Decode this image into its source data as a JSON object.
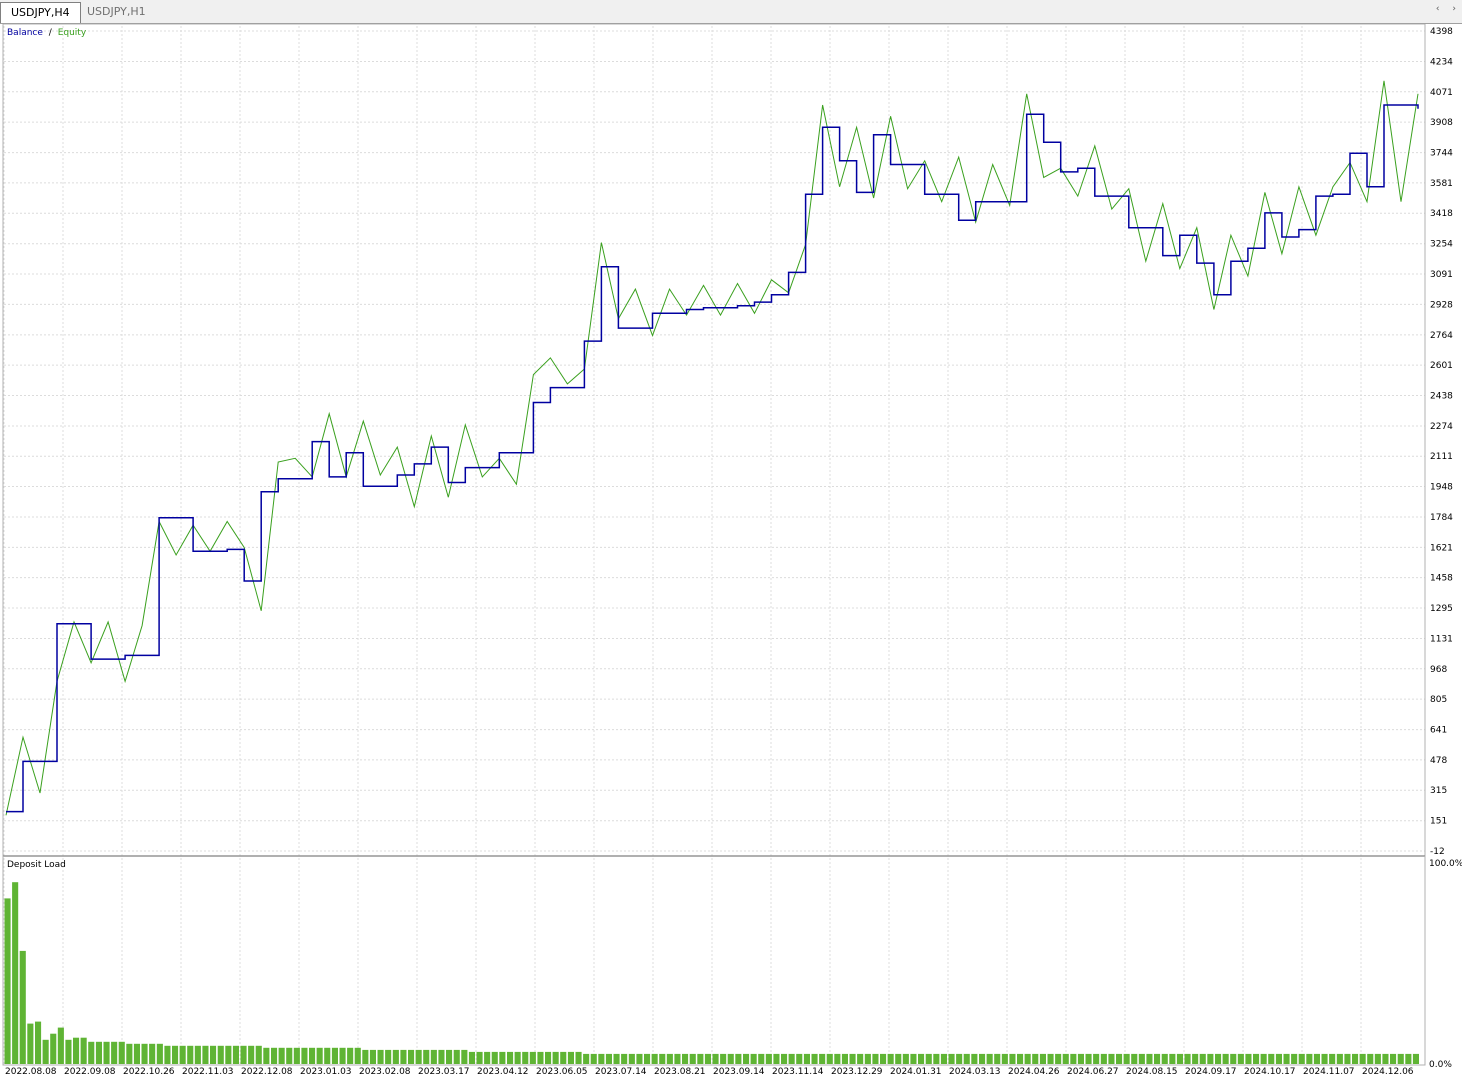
{
  "tabs": [
    {
      "label": "USDJPY,H4",
      "active": true
    },
    {
      "label": "USDJPY,H1",
      "active": false
    }
  ],
  "tab_arrows": {
    "left": "‹",
    "right": "›"
  },
  "colors": {
    "balance": "#0000a0",
    "equity": "#3aa01e",
    "deposit": "#5fb434",
    "grid": "#dcdcdc"
  },
  "chart_data": [
    {
      "type": "line",
      "legend": {
        "balance_label": "Balance",
        "separator": "/",
        "equity_label": "Equity",
        "position": "top-left"
      },
      "y_ticks": [
        "4398",
        "4234",
        "4071",
        "3908",
        "3744",
        "3581",
        "3418",
        "3254",
        "3091",
        "2928",
        "2764",
        "2601",
        "2438",
        "2274",
        "2111",
        "1948",
        "1784",
        "1621",
        "1458",
        "1295",
        "1131",
        "968",
        "805",
        "641",
        "478",
        "315",
        "151",
        "-12"
      ],
      "ylim": [
        -12,
        4398
      ],
      "x_ticks": [
        "2022.08.08",
        "2022.09.08",
        "2022.10.26",
        "2022.11.03",
        "2022.12.08",
        "2023.01.03",
        "2023.02.08",
        "2023.03.17",
        "2023.04.12",
        "2023.06.05",
        "2023.07.14",
        "2023.08.21",
        "2023.09.14",
        "2023.11.14",
        "2023.12.29",
        "2024.01.31",
        "2024.03.13",
        "2024.04.26",
        "2024.06.27",
        "2024.08.15",
        "2024.09.17",
        "2024.10.17",
        "2024.11.07",
        "2024.12.06"
      ],
      "grid": true,
      "series": [
        {
          "name": "Balance",
          "values": [
            200,
            470,
            470,
            1210,
            1210,
            1020,
            1020,
            1040,
            1040,
            1780,
            1780,
            1600,
            1600,
            1610,
            1440,
            1920,
            1990,
            1990,
            2190,
            2000,
            2130,
            1950,
            1950,
            2010,
            2070,
            2160,
            1970,
            2050,
            2050,
            2130,
            2130,
            2400,
            2480,
            2480,
            2730,
            3130,
            2800,
            2800,
            2880,
            2880,
            2900,
            2910,
            2910,
            2920,
            2940,
            2980,
            3100,
            3520,
            3880,
            3700,
            3530,
            3840,
            3680,
            3680,
            3520,
            3520,
            3380,
            3480,
            3480,
            3480,
            3950,
            3800,
            3640,
            3660,
            3510,
            3510,
            3340,
            3340,
            3190,
            3300,
            3150,
            2980,
            3160,
            3230,
            3420,
            3290,
            3330,
            3510,
            3520,
            3740,
            3560,
            4000,
            4000,
            3980
          ]
        },
        {
          "name": "Equity",
          "values": [
            180,
            600,
            300,
            900,
            1220,
            1000,
            1220,
            900,
            1200,
            1760,
            1580,
            1740,
            1600,
            1760,
            1620,
            1280,
            2080,
            2100,
            2000,
            2340,
            2000,
            2300,
            2010,
            2160,
            1840,
            2220,
            1890,
            2280,
            2000,
            2100,
            1960,
            2550,
            2640,
            2500,
            2580,
            3260,
            2850,
            3010,
            2760,
            3010,
            2870,
            3030,
            2870,
            3040,
            2880,
            3060,
            2990,
            3250,
            4000,
            3560,
            3880,
            3500,
            3940,
            3550,
            3700,
            3480,
            3720,
            3370,
            3680,
            3460,
            4060,
            3610,
            3660,
            3510,
            3780,
            3440,
            3550,
            3160,
            3470,
            3120,
            3340,
            2900,
            3300,
            3080,
            3530,
            3200,
            3560,
            3300,
            3560,
            3690,
            3480,
            4130,
            3480,
            4060
          ]
        }
      ]
    },
    {
      "type": "bar",
      "title": "Deposit Load",
      "y_ticks": [
        "100.0%",
        "0.0%"
      ],
      "ylim": [
        0,
        100
      ],
      "values": [
        82,
        90,
        56,
        20,
        21,
        12,
        15,
        18,
        12,
        13,
        13,
        11,
        11,
        11,
        11,
        11,
        10,
        10,
        10,
        10,
        10,
        9,
        9,
        9,
        9,
        9,
        9,
        9,
        9,
        9,
        9,
        9,
        9,
        9,
        8,
        8,
        8,
        8,
        8,
        8,
        8,
        8,
        8,
        8,
        8,
        8,
        8,
        7,
        7,
        7,
        7,
        7,
        7,
        7,
        7,
        7,
        7,
        7,
        7,
        7,
        7,
        6,
        6,
        6,
        6,
        6,
        6,
        6,
        6,
        6,
        6,
        6,
        6,
        6,
        6,
        6,
        5,
        5,
        5,
        5,
        5,
        5,
        5,
        5,
        5,
        5,
        5,
        5,
        5,
        5,
        5,
        5,
        5,
        5,
        5,
        5,
        5,
        5,
        5,
        5,
        5,
        5,
        5,
        5,
        5,
        5,
        5,
        5,
        5,
        5,
        5,
        5,
        5,
        5,
        5,
        5,
        5,
        5,
        5,
        5,
        5,
        5,
        5,
        5,
        5,
        5,
        5,
        5,
        5,
        5,
        5,
        5,
        5,
        5,
        5,
        5,
        5,
        5,
        5,
        5,
        5,
        5,
        5,
        5,
        5,
        5,
        5,
        5,
        5,
        5,
        5,
        5,
        5,
        5,
        5,
        5,
        5,
        5,
        5,
        5,
        5,
        5,
        5,
        5,
        5,
        5,
        5,
        5,
        5,
        5,
        5,
        5,
        5,
        5,
        5,
        5,
        5,
        5,
        5,
        5,
        5,
        5,
        5,
        5,
        5,
        5
      ]
    }
  ]
}
